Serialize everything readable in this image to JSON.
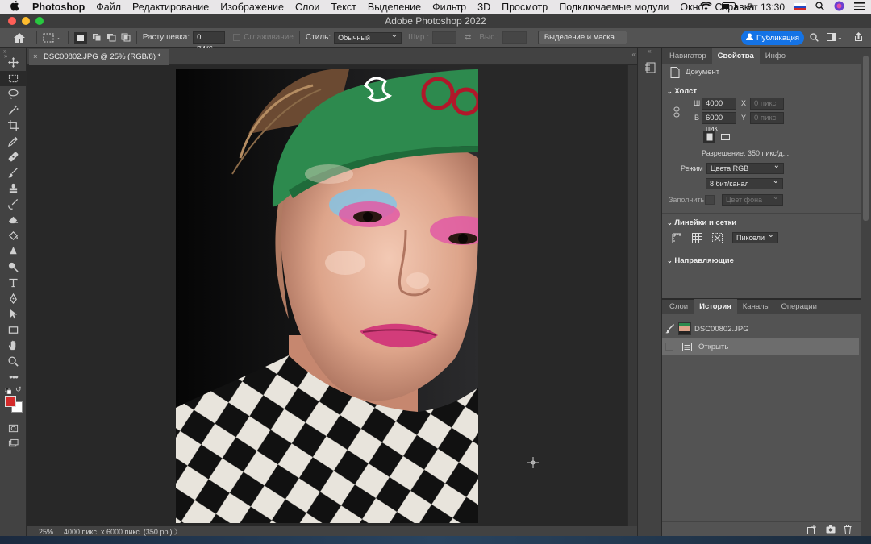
{
  "menubar": {
    "apple": "",
    "app_name": "Photoshop",
    "items": [
      "Файл",
      "Редактирование",
      "Изображение",
      "Слои",
      "Текст",
      "Выделение",
      "Фильтр",
      "3D",
      "Просмотр",
      "Подключаемые модули",
      "Окно",
      "Справка"
    ],
    "clock": "Вт 13:30"
  },
  "window": {
    "title": "Adobe Photoshop 2022"
  },
  "options": {
    "feather_label": "Растушевка:",
    "feather_value": "0 пикс.",
    "antialias_label": "Сглаживание",
    "style_label": "Стиль:",
    "style_value": "Обычный",
    "width_label": "Шир.:",
    "height_label": "Выс.:",
    "select_mask_button": "Выделение и маска...",
    "publish_button": "Публикация"
  },
  "document": {
    "tab_title": "DSC00802.JPG @ 25% (RGB/8) *",
    "close_glyph": "×"
  },
  "status": {
    "zoom": "25%",
    "info": "4000 пикс. x 6000 пикс. (350 ppi)",
    "arrow": "〉"
  },
  "properties_panel": {
    "tabs": [
      "Навигатор",
      "Свойства",
      "Инфо"
    ],
    "active_tab": "Свойства",
    "doc_label": "Документ",
    "canvas": {
      "header": "Холст",
      "w_label": "Ш",
      "w_value": "4000 пик",
      "x_label": "X",
      "x_value": "0 пикс",
      "h_label": "В",
      "h_value": "6000 пик",
      "y_label": "Y",
      "y_value": "0 пикс",
      "resolution": "Разрешение: 350 пикс/д...",
      "mode_label": "Режим",
      "mode_value": "Цвета RGB",
      "depth_value": "8 бит/канал",
      "fill_label": "Заполнить",
      "fill_value": "Цвет фона"
    },
    "rulers": {
      "header": "Линейки и сетки",
      "units": "Пиксели"
    },
    "guides": {
      "header": "Направляющие"
    }
  },
  "history_panel": {
    "tabs": [
      "Слои",
      "История",
      "Каналы",
      "Операции"
    ],
    "active_tab": "История",
    "snapshot": "DSC00802.JPG",
    "states": [
      "Открыть"
    ]
  },
  "colors": {
    "foreground": "#d42a2a",
    "background": "#ffffff",
    "accent": "#1473e6"
  }
}
